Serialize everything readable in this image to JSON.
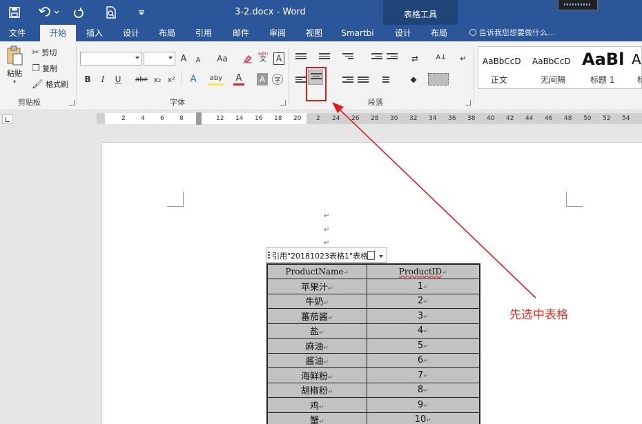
{
  "quick_access": {
    "save": "save-icon",
    "undo": "undo-icon",
    "redo": "redo-icon",
    "preview": "print-preview-icon",
    "customize": "customize-icon"
  },
  "window": {
    "title": "3-2.docx - Word",
    "table_tools": "表格工具"
  },
  "tabs": [
    {
      "label": "文件"
    },
    {
      "label": "开始"
    },
    {
      "label": "插入"
    },
    {
      "label": "设计"
    },
    {
      "label": "布局"
    },
    {
      "label": "引用"
    },
    {
      "label": "邮件"
    },
    {
      "label": "审阅"
    },
    {
      "label": "视图"
    },
    {
      "label": "Smartbi"
    },
    {
      "label": "设计"
    },
    {
      "label": "布局"
    }
  ],
  "tell_me": "告诉我您想要做什么...",
  "clipboard": {
    "paste": "粘贴",
    "cut": "剪切",
    "copy": "复制",
    "format_painter": "格式刷",
    "group": "剪贴板"
  },
  "font": {
    "group": "字体",
    "grow": "A",
    "shrink": "A",
    "case": "Aa",
    "phonetic_top": "wén",
    "phonetic_bottom": "文",
    "border_char": "A",
    "bold": "B",
    "italic": "I",
    "underline": "U",
    "strike": "abc",
    "sub": "x₂",
    "sup": "x²",
    "effects": "A",
    "highlight": "aby",
    "color": "A",
    "shade": "A",
    "enclose": "字"
  },
  "paragraph": {
    "group": "段落",
    "sort": "A↓"
  },
  "styles": [
    {
      "sample": "AaBbCcD",
      "name": "正文"
    },
    {
      "sample": "AaBbCcD",
      "name": "无间隔"
    },
    {
      "sample": "AaBl",
      "name": "标题 1"
    },
    {
      "sample": "A",
      "name": "标"
    }
  ],
  "ruler": {
    "left_numbers": [
      "2",
      "4",
      "6",
      "8"
    ],
    "right_numbers": [
      "12",
      "14",
      "16",
      "18",
      "20",
      "2",
      "24",
      "26",
      "28",
      "30",
      "32",
      "34",
      "36",
      "38",
      "40",
      "42",
      "44",
      "46",
      "48",
      "50",
      "52",
      "54"
    ]
  },
  "doc": {
    "table_tag": "引用\"20181023表格1\"表格",
    "table": {
      "headers": [
        "ProductName",
        "ProductID"
      ],
      "rows": [
        [
          "苹果汁",
          "1"
        ],
        [
          "牛奶",
          "2"
        ],
        [
          "蕃茄酱",
          "3"
        ],
        [
          "盐",
          "4"
        ],
        [
          "麻油",
          "5"
        ],
        [
          "酱油",
          "6"
        ],
        [
          "海鲜粉",
          "7"
        ],
        [
          "胡椒粉",
          "8"
        ],
        [
          "鸡",
          "9"
        ],
        [
          "蟹",
          "10"
        ]
      ]
    },
    "annotation": "先选中表格",
    "para_mark": "↵",
    "cell_mark": "↵"
  }
}
